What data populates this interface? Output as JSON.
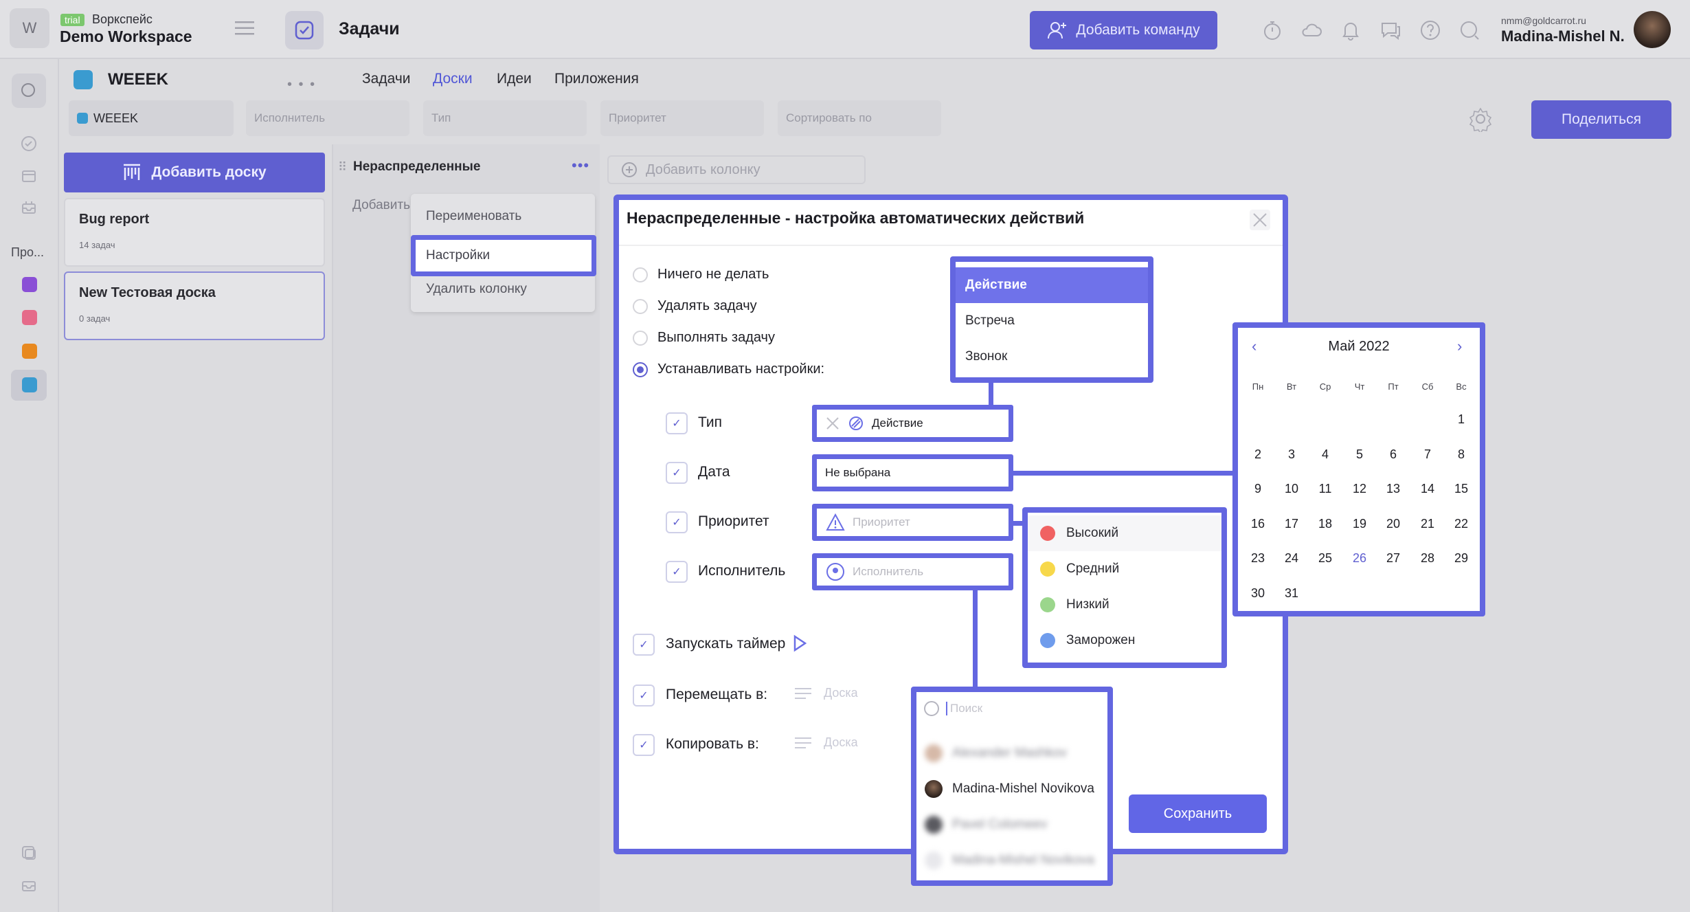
{
  "workspace": {
    "logo_letter": "W",
    "badge": "trial",
    "subtitle": "Воркспейс",
    "name": "Demo Workspace"
  },
  "header": {
    "title": "Задачи",
    "add_team_label": "Добавить команду",
    "icons": [
      "timer-icon",
      "cloud-icon",
      "bell-icon",
      "chat-icon",
      "help-icon",
      "search-icon"
    ],
    "user_email": "nmm@goldcarrot.ru",
    "user_name": "Madina-Mishel N."
  },
  "rail": {
    "projects_label": "Про...",
    "project_colors": [
      "#8a4fd6",
      "#e56b8a",
      "#e8891f",
      "#3a9bd0"
    ]
  },
  "project": {
    "name": "WEEEK",
    "more": "• • •",
    "tabs": [
      "Задачи",
      "Доски",
      "Идеи",
      "Приложения"
    ],
    "active_tab": "Доски",
    "filters": {
      "project": "WEEEK",
      "assignee_placeholder": "Исполнитель",
      "type_placeholder": "Тип",
      "priority_placeholder": "Приоритет",
      "sort_placeholder": "Сортировать по"
    },
    "share_label": "Поделиться"
  },
  "boards": {
    "add_label": "Добавить доску",
    "items": [
      {
        "title": "Bug report",
        "count": "14 задач"
      },
      {
        "title": "New Тестовая доска",
        "count": "0 задач"
      }
    ]
  },
  "column": {
    "title": "Нераспределенные",
    "add_task_label": "Добавить",
    "add_column_label": "Добавить колонку",
    "menu": [
      "Переименовать",
      "Настройки",
      "Удалить колонку"
    ]
  },
  "modal": {
    "title": "Нераспределенные - настройка автоматических действий",
    "radio_options": [
      "Ничего не делать",
      "Удалять задачу",
      "Выполнять задачу",
      "Устанавливать настройки:"
    ],
    "selected_radio": 3,
    "settings": {
      "type_label": "Тип",
      "type_value": "Действие",
      "date_label": "Дата",
      "date_value": "Не выбрана",
      "priority_label": "Приоритет",
      "priority_placeholder": "Приоритет",
      "assignee_label": "Исполнитель",
      "assignee_placeholder": "Исполнитель"
    },
    "timer_label": "Запускать таймер",
    "move_label": "Перемещать в:",
    "copy_label": "Копировать в:",
    "board_placeholder": "Доска",
    "save_label": "Сохранить"
  },
  "type_dropdown": {
    "items": [
      "Действие",
      "Встреча",
      "Звонок"
    ],
    "selected": "Действие"
  },
  "priority_dropdown": {
    "items": [
      {
        "label": "Высокий",
        "color": "#f06262"
      },
      {
        "label": "Средний",
        "color": "#f7d84b"
      },
      {
        "label": "Низкий",
        "color": "#9bd68c"
      },
      {
        "label": "Заморожен",
        "color": "#6f9cec"
      }
    ]
  },
  "calendar": {
    "month_label": "Май 2022",
    "weekdays": [
      "Пн",
      "Вт",
      "Ср",
      "Чт",
      "Пт",
      "Сб",
      "Вс"
    ],
    "days": [
      "1",
      "2",
      "3",
      "4",
      "5",
      "6",
      "7",
      "8",
      "9",
      "10",
      "11",
      "12",
      "13",
      "14",
      "15",
      "16",
      "17",
      "18",
      "19",
      "20",
      "21",
      "22",
      "23",
      "24",
      "25",
      "26",
      "27",
      "28",
      "29",
      "30",
      "31"
    ],
    "first_weekday_index": 6,
    "today": "26"
  },
  "people_dropdown": {
    "search_placeholder": "Поиск",
    "people": [
      {
        "name": "Alexander Mashkov",
        "blurred": true
      },
      {
        "name": "Madina-Mishel Novikova",
        "blurred": false
      },
      {
        "name": "Pavel Colomeev",
        "blurred": true
      },
      {
        "name": "Madina-Mishel Novikova",
        "blurred": true
      }
    ]
  }
}
